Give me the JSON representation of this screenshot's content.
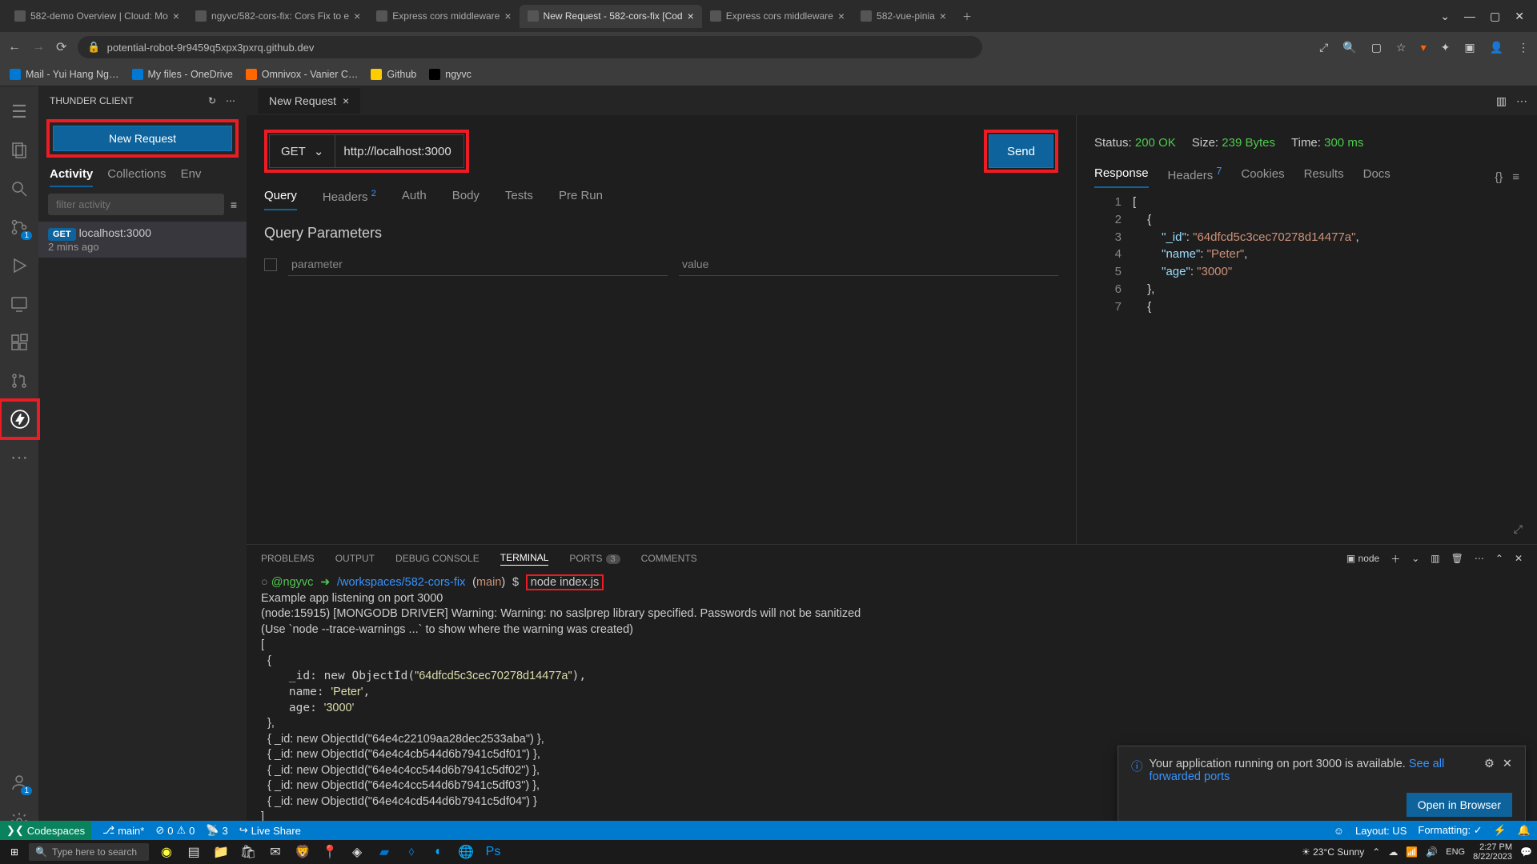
{
  "chrome": {
    "tabs": [
      {
        "label": "582-demo Overview | Cloud: Mo"
      },
      {
        "label": "ngyvc/582-cors-fix: Cors Fix to e"
      },
      {
        "label": "Express cors middleware"
      },
      {
        "label": "New Request - 582-cors-fix [Cod",
        "active": true
      },
      {
        "label": "Express cors middleware"
      },
      {
        "label": "582-vue-pinia"
      }
    ],
    "url": "potential-robot-9r9459q5xpx3pxrq.github.dev",
    "bookmarks": [
      "Mail - Yui Hang Ng…",
      "My files - OneDrive",
      "Omnivox - Vanier C…",
      "Github",
      "ngyvc"
    ]
  },
  "thunder": {
    "title": "THUNDER CLIENT",
    "newRequest": "New Request",
    "sideTabs": [
      "Activity",
      "Collections",
      "Env"
    ],
    "filterPlaceholder": "filter activity",
    "activity": {
      "method": "GET",
      "url": "localhost:3000",
      "time": "2 mins ago"
    }
  },
  "editor": {
    "tabTitle": "New Request",
    "method": "GET",
    "url": "http://localhost:3000",
    "send": "Send",
    "reqTabs": {
      "query": "Query",
      "headers": "Headers",
      "headersBadge": "2",
      "auth": "Auth",
      "body": "Body",
      "tests": "Tests",
      "prerun": "Pre Run"
    },
    "qpTitle": "Query Parameters",
    "qpParam": "parameter",
    "qpValue": "value"
  },
  "response": {
    "statusLabel": "Status:",
    "statusVal": "200 OK",
    "sizeLabel": "Size:",
    "sizeVal": "239 Bytes",
    "timeLabel": "Time:",
    "timeVal": "300 ms",
    "tabs": {
      "response": "Response",
      "headers": "Headers",
      "headersBadge": "7",
      "cookies": "Cookies",
      "results": "Results",
      "docs": "Docs"
    },
    "json": [
      {
        "_id": "64dfcd5c3cec70278d14477a",
        "name": "Peter",
        "age": "3000"
      }
    ]
  },
  "panel": {
    "tabs": {
      "problems": "PROBLEMS",
      "output": "OUTPUT",
      "debug": "DEBUG CONSOLE",
      "terminal": "TERMINAL",
      "ports": "PORTS",
      "portsBadge": "3",
      "comments": "COMMENTS"
    },
    "termKind": "node",
    "prompt": {
      "user": "@ngyvc",
      "arrow": "➜",
      "path": "/workspaces/582-cors-fix",
      "branch": "main",
      "dollar": "$",
      "cmd": "node index.js"
    },
    "lines": [
      "Example app listening on port 3000",
      "(node:15915) [MONGODB DRIVER] Warning: Warning: no saslprep library specified. Passwords will not be sanitized",
      "(Use `node --trace-warnings ...` to show where the warning was created)",
      "[",
      "  {",
      "    _id: new ObjectId(\"64dfcd5c3cec70278d14477a\"),",
      "    name: 'Peter',",
      "    age: '3000'",
      "  },",
      "  { _id: new ObjectId(\"64e4c22109aa28dec2533aba\") },",
      "  { _id: new ObjectId(\"64e4c4cb544d6b7941c5df01\") },",
      "  { _id: new ObjectId(\"64e4c4cc544d6b7941c5df02\") },",
      "  { _id: new ObjectId(\"64e4c4cc544d6b7941c5df03\") },",
      "  { _id: new ObjectId(\"64e4c4cd544d6b7941c5df04\") }",
      "]",
      "▯"
    ]
  },
  "notif": {
    "text": "Your application running on port 3000 is available. ",
    "link": "See all forwarded ports",
    "button": "Open in Browser"
  },
  "statusbar": {
    "codespaces": "Codespaces",
    "branch": "main*",
    "errors": "0",
    "warnings": "0",
    "ports": "3",
    "liveshare": "Live Share",
    "layout": "Layout: US",
    "formatting": "Formatting: ✓"
  },
  "taskbar": {
    "search": "Type here to search",
    "weather": "23°C  Sunny",
    "time": "2:27 PM",
    "date": "8/22/2023"
  }
}
